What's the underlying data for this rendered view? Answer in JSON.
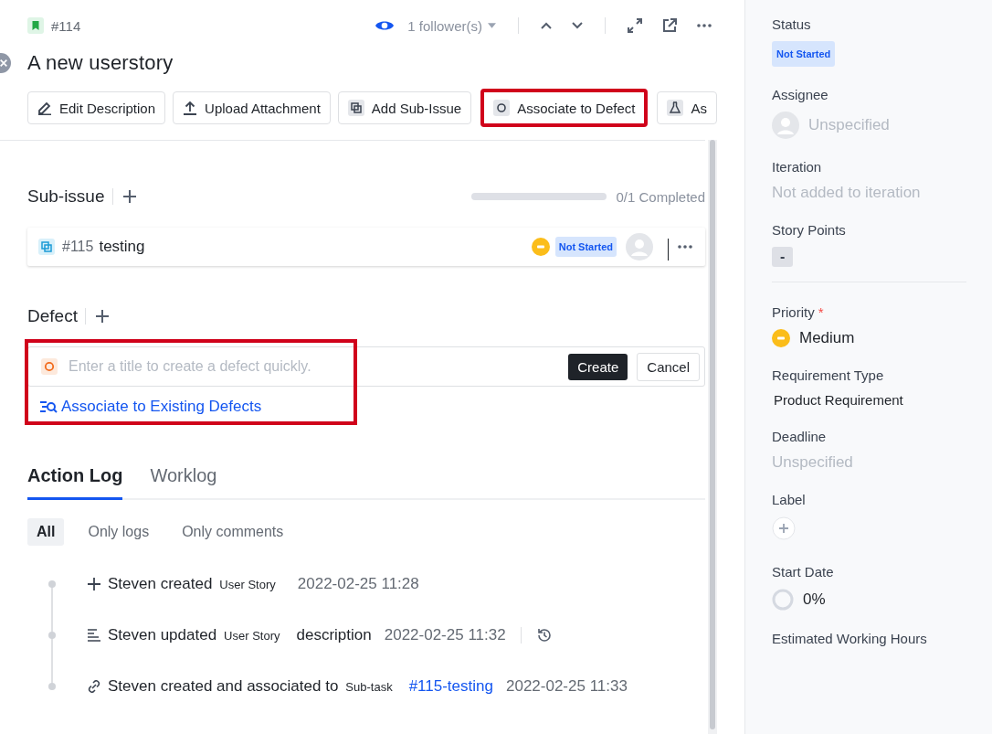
{
  "header": {
    "issue_number": "#114",
    "followers": "1 follower(s)",
    "title": "A new userstory"
  },
  "toolbar": [
    {
      "label": "Edit Description",
      "kind": "edit",
      "highlighted": false
    },
    {
      "label": "Upload Attachment",
      "kind": "upload",
      "highlighted": false
    },
    {
      "label": "Add Sub-Issue",
      "kind": "subissue",
      "highlighted": false
    },
    {
      "label": "Associate to Defect",
      "kind": "defect",
      "highlighted": true
    },
    {
      "label": "As",
      "kind": "test",
      "highlighted": false
    }
  ],
  "sub_issue": {
    "heading": "Sub-issue",
    "level": 0,
    "progress_text": "0/1 Completed",
    "items": [
      {
        "number": "#115",
        "title": "testing",
        "status": "Not Started"
      }
    ]
  },
  "defect": {
    "heading": "Defect",
    "highlighted": true,
    "placeholder": "Enter a title to create a defect quickly.",
    "create": "Create",
    "cancel": "Cancel",
    "associate_link": "Associate to Existing Defects"
  },
  "log_tabs": [
    {
      "label": "Action Log",
      "selected": true
    },
    {
      "label": "Worklog",
      "selected": false
    }
  ],
  "filters": [
    {
      "label": "All",
      "selected": true
    },
    {
      "label": "Only logs",
      "selected": false
    },
    {
      "label": "Only comments",
      "selected": false
    }
  ],
  "entries": [
    {
      "kind": "create",
      "text": "Steven created",
      "tag": "User Story",
      "time": "2022-02-25 11:28"
    },
    {
      "kind": "update",
      "text": "Steven updated",
      "tag": "User Story",
      "after": "description",
      "time": "2022-02-25 11:32"
    },
    {
      "kind": "associate",
      "text": "Steven created and associated to",
      "tag": "Sub-task",
      "link": "#115-testing",
      "time": "2022-02-25 11:33"
    }
  ],
  "sidebar": [
    {
      "kind": "status",
      "label": "Status",
      "value": "Not Started"
    },
    {
      "kind": "person",
      "label": "Assignee",
      "placeholder": "Unspecified"
    },
    {
      "kind": "muted",
      "label": "Iteration",
      "placeholder": "Not added to iteration"
    },
    {
      "kind": "points",
      "label": "Story Points",
      "value": "-"
    },
    {
      "kind": "divider"
    },
    {
      "kind": "priority",
      "label": "Priority",
      "required_mark": "*",
      "value": "Medium"
    },
    {
      "kind": "plain",
      "label": "Requirement Type",
      "value": "Product Requirement"
    },
    {
      "kind": "muted",
      "label": "Deadline",
      "placeholder": "Unspecified"
    },
    {
      "kind": "add",
      "label": "Label"
    },
    {
      "kind": "progress",
      "label": "Start Date",
      "value": "0%"
    },
    {
      "kind": "heading",
      "label": "Estimated Working Hours"
    }
  ]
}
